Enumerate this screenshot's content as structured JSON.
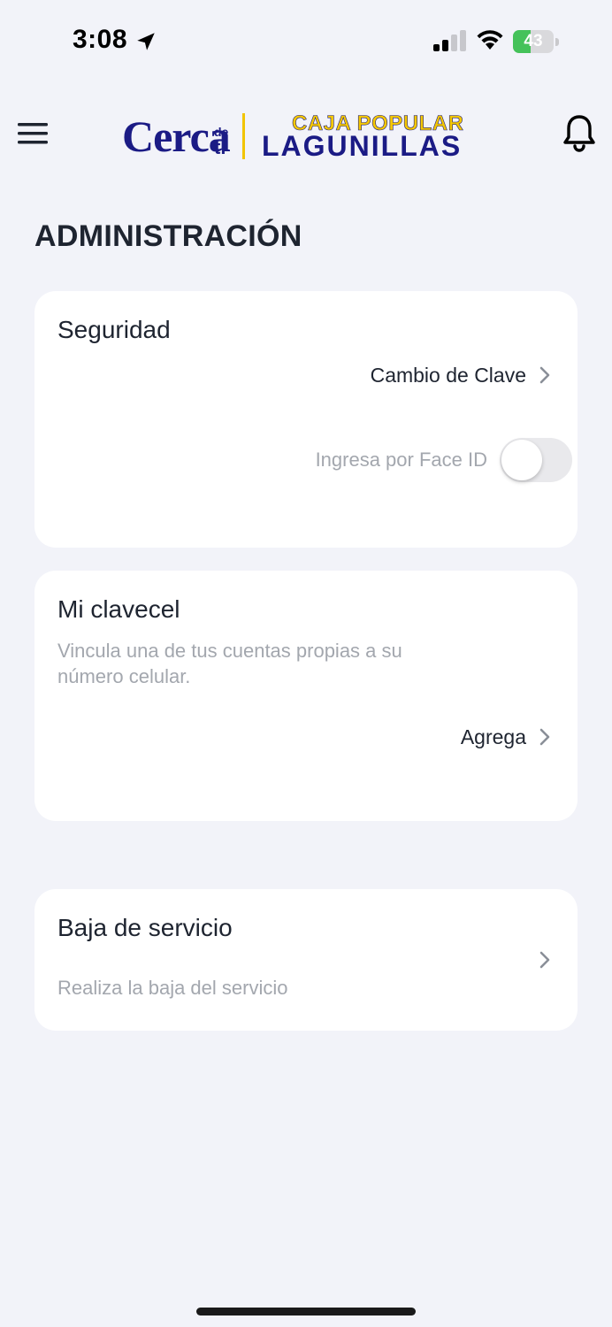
{
  "status_bar": {
    "time": "3:08",
    "battery_percent": "43",
    "battery_level": 0.43,
    "battery_color": "#45c25a"
  },
  "header": {
    "menu_icon": "hamburger-menu-icon",
    "notification_icon": "bell-icon",
    "logo": {
      "word": "Cerca",
      "small_de": "de",
      "small_ti": "ti",
      "line1": "CAJA POPULAR",
      "line2": "LAGUNILLAS",
      "brand_blue": "#1b1b85",
      "brand_yellow": "#f5c800"
    }
  },
  "page_title": "ADMINISTRACIÓN",
  "security_card": {
    "title": "Seguridad",
    "change_password_label": "Cambio de Clave",
    "face_id_label": "Ingresa por Face ID",
    "face_id_enabled": false
  },
  "clavecel_card": {
    "title": "Mi clavecel",
    "description": "Vincula una de tus cuentas propias a su número celular.",
    "add_label": "Agrega"
  },
  "unsubscribe_card": {
    "title": "Baja de servicio",
    "description": "Realiza la baja del servicio"
  }
}
